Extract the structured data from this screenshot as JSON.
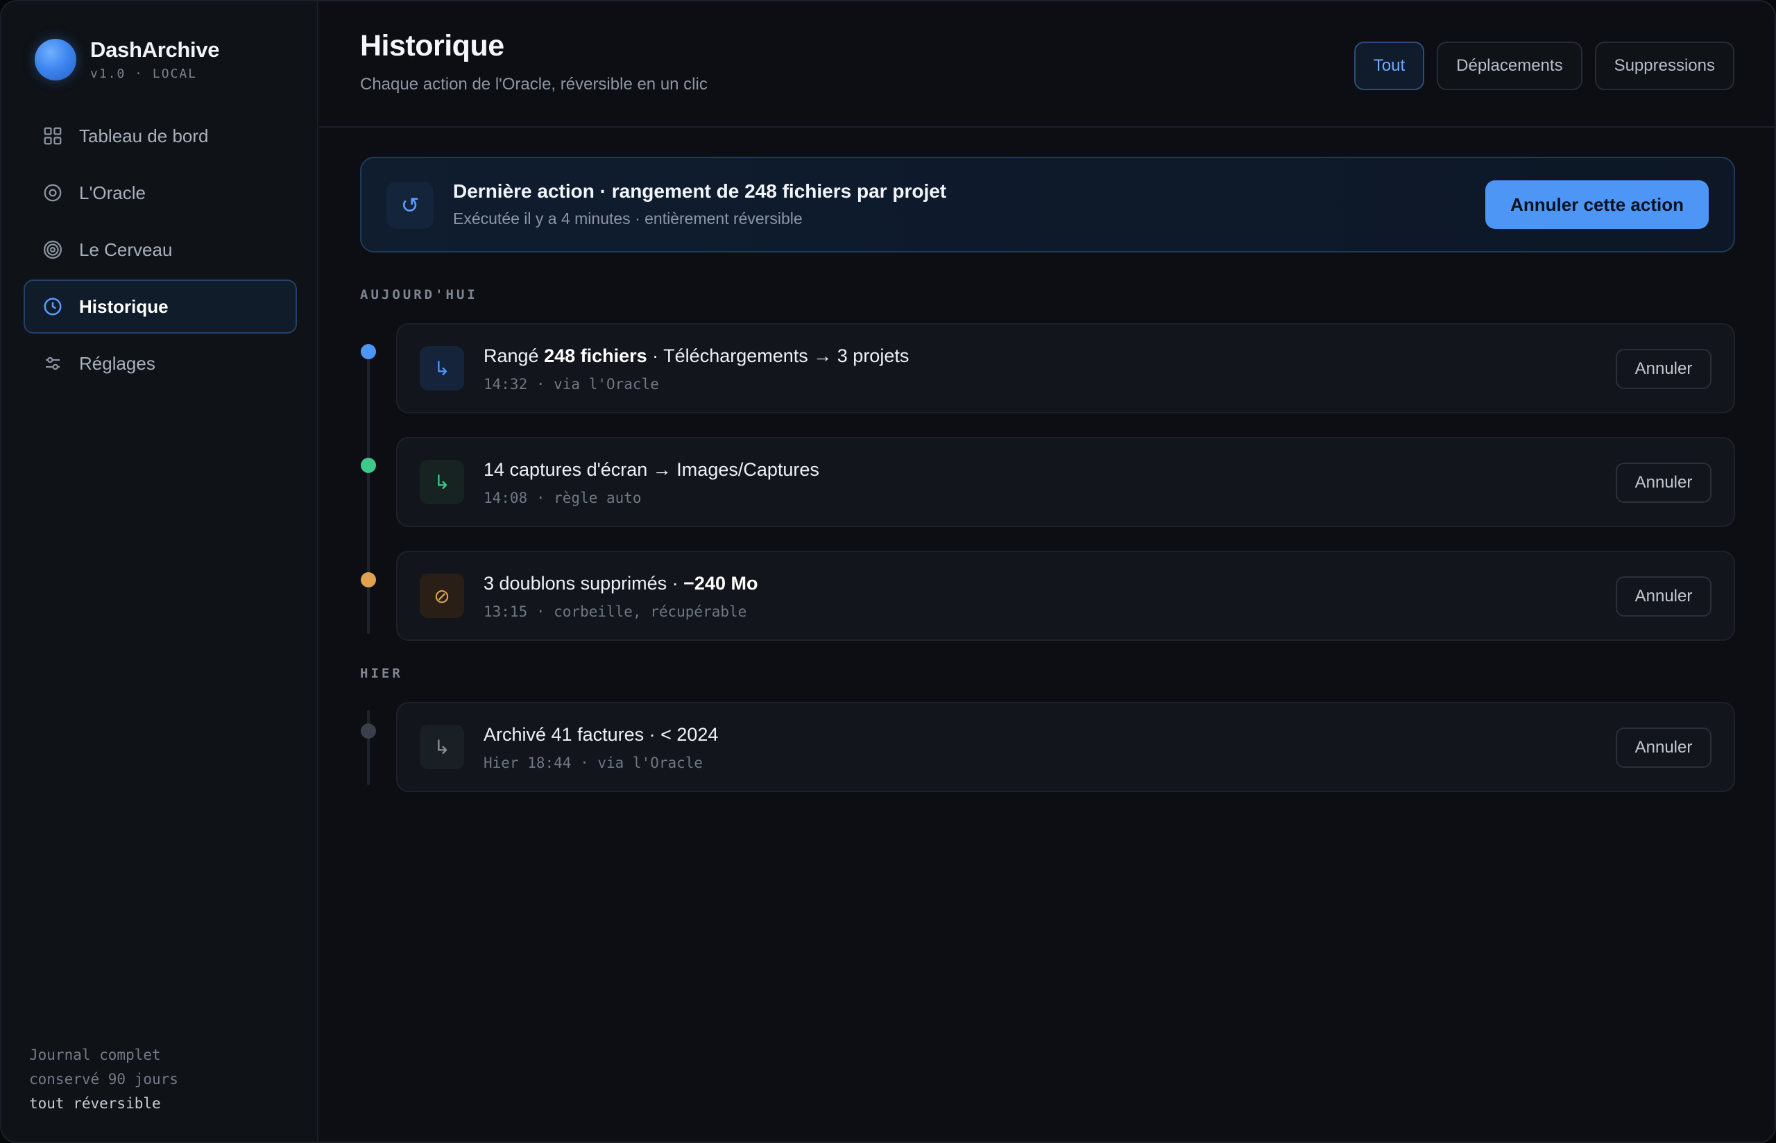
{
  "brand": {
    "name": "DashArchive",
    "version": "v1.0 · LOCAL"
  },
  "sidebar": {
    "items": [
      {
        "label": "Tableau de bord",
        "icon": "grid-icon"
      },
      {
        "label": "L'Oracle",
        "icon": "target-icon"
      },
      {
        "label": "Le Cerveau",
        "icon": "rings-icon"
      },
      {
        "label": "Historique",
        "icon": "clock-icon",
        "active": true
      },
      {
        "label": "Réglages",
        "icon": "sliders-icon"
      }
    ],
    "footer": {
      "line1": "Journal complet",
      "line2": "conservé 90 jours",
      "line3": "tout réversible"
    }
  },
  "header": {
    "title": "Historique",
    "subtitle": "Chaque action de l'Oracle, réversible en un clic",
    "filters": [
      {
        "label": "Tout",
        "active": true
      },
      {
        "label": "Déplacements"
      },
      {
        "label": "Suppressions"
      }
    ]
  },
  "banner": {
    "icon": "undo-icon",
    "title": "Dernière action · rangement de 248 fichiers par projet",
    "subtitle": "Exécutée il y a 4 minutes · entièrement réversible",
    "button": "Annuler cette action"
  },
  "sections": [
    {
      "label": "AUJOURD'HUI",
      "entries": [
        {
          "title_pre": "Rangé ",
          "title_bold": "248 fichiers",
          "title_post": " · Téléchargements → 3 projets",
          "meta": "14:32 · via l'Oracle",
          "button": "Annuler",
          "dot_color": "#4d96f5",
          "icon": "move-arrow-icon",
          "icon_color": "#4d96f5",
          "icon_bg": "#15243a"
        },
        {
          "title_pre": "14 captures d'écran → Images/Captures",
          "title_bold": "",
          "title_post": "",
          "meta": "14:08 · règle auto",
          "button": "Annuler",
          "dot_color": "#3ec98a",
          "icon": "move-arrow-icon",
          "icon_color": "#3ec98a",
          "icon_bg": "#172320"
        },
        {
          "title_pre": "3 doublons supprimés · ",
          "title_bold": "−240 Mo",
          "title_post": "",
          "meta": "13:15 · corbeille, récupérable",
          "button": "Annuler",
          "dot_color": "#e0a24e",
          "icon": "prohibit-icon",
          "icon_color": "#e0a24e",
          "icon_bg": "#2a1f17"
        }
      ]
    },
    {
      "label": "HIER",
      "entries": [
        {
          "title_pre": "Archivé 41 factures · < 2024",
          "title_bold": "",
          "title_post": "",
          "meta": "Hier 18:44 · via l'Oracle",
          "button": "Annuler",
          "dot_color": "#3a404b",
          "icon": "move-arrow-icon",
          "icon_color": "#8a919c",
          "icon_bg": "#1a1e25"
        }
      ]
    }
  ]
}
